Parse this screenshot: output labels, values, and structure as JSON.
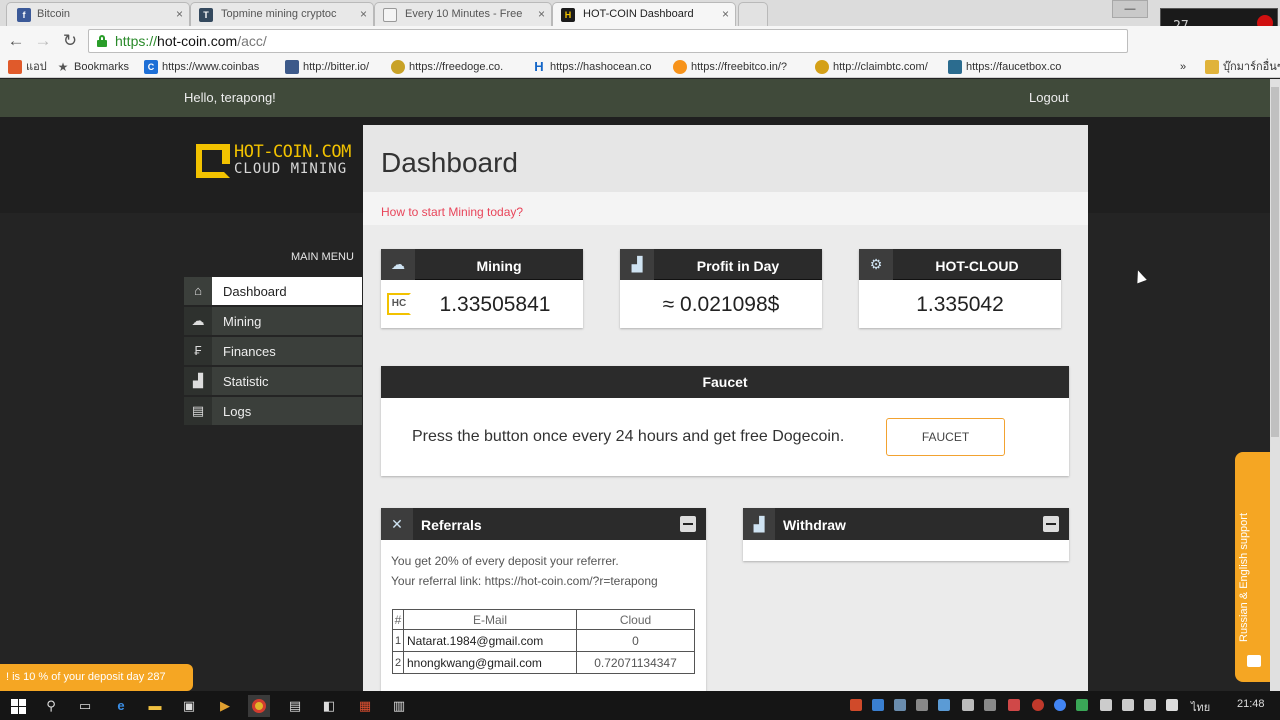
{
  "browser": {
    "tabs": [
      {
        "title": "Bitcoin",
        "icon": "facebook-icon",
        "color": "#3b5998",
        "glyph": "f"
      },
      {
        "title": "Topmine mining cryptoc",
        "icon": "topmine-icon",
        "color": "#34495e",
        "glyph": "T"
      },
      {
        "title": "Every 10 Minutes - Free",
        "icon": "page-icon",
        "color": "#9e9e9e",
        "glyph": ""
      },
      {
        "title": "HOT-COIN Dashboard",
        "icon": "hotcoin-icon",
        "color": "#1b1b1b",
        "glyph": "H"
      }
    ],
    "url": {
      "scheme": "https://",
      "host": "hot-coin.com",
      "path": "/acc/"
    },
    "bookmarks": [
      {
        "label": "แอป",
        "icon": "apps-icon",
        "color": "#e05a2b",
        "glyph": ""
      },
      {
        "label": "Bookmarks",
        "icon": "star-icon",
        "color": "#666666",
        "glyph": "★"
      },
      {
        "label": "https://www.coinbas",
        "icon": "coinbase-icon",
        "color": "#1d6fd6",
        "glyph": "C"
      },
      {
        "label": "http://bitter.io/",
        "icon": "bitter-icon",
        "color": "#3d5a8a",
        "glyph": ""
      },
      {
        "label": "https://freedoge.co.",
        "icon": "freedoge-icon",
        "color": "#c8a227",
        "glyph": ""
      },
      {
        "label": "https://hashocean.co",
        "icon": "hashocean-icon",
        "color": "#1466c8",
        "glyph": "H"
      },
      {
        "label": "https://freebitco.in/?",
        "icon": "freebitco-icon",
        "color": "#f7931a",
        "glyph": ""
      },
      {
        "label": "http://claimbtc.com/",
        "icon": "claimbtc-icon",
        "color": "#d4a017",
        "glyph": ""
      },
      {
        "label": "https://faucetbox.co",
        "icon": "faucetbox-icon",
        "color": "#2b6c8f",
        "glyph": ""
      },
      {
        "label": "บุ๊กมาร์กอื่นๆ",
        "icon": "folder-icon",
        "color": "#e0b33a",
        "glyph": ""
      }
    ],
    "recorder_value": "27"
  },
  "site": {
    "greeting": "Hello, terapong!",
    "logout": "Logout",
    "logo": {
      "title": "HOT-COIN.COM",
      "subtitle": "CLOUD MINING"
    },
    "menu_heading": "MAIN MENU",
    "menu": [
      {
        "label": "Dashboard",
        "icon": "home-icon",
        "glyph": "⌂",
        "active": true
      },
      {
        "label": "Mining",
        "icon": "cloud-icon",
        "glyph": "☁",
        "active": false
      },
      {
        "label": "Finances",
        "icon": "finance-icon",
        "glyph": "₣",
        "active": false
      },
      {
        "label": "Statistic",
        "icon": "chart-icon",
        "glyph": "▟",
        "active": false
      },
      {
        "label": "Logs",
        "icon": "clipboard-icon",
        "glyph": "▤",
        "active": false
      }
    ],
    "page_title": "Dashboard",
    "hint_link": "How to start Mining today?",
    "stats": [
      {
        "label": "Mining",
        "value": "1.33505841",
        "icon": "cloud-icon",
        "glyph": "☁",
        "badge": "HC"
      },
      {
        "label": "Profit in Day",
        "value": "≈ 0.021098$",
        "icon": "bar-chart-icon",
        "glyph": "▟",
        "badge": ""
      },
      {
        "label": "HOT-CLOUD",
        "value": "1.335042",
        "icon": "gear-icon",
        "glyph": "⚙",
        "badge": ""
      }
    ],
    "faucet": {
      "title": "Faucet",
      "text": "Press the button once every 24 hours and get free Dogecoin.",
      "button": "FAUCET"
    },
    "referrals": {
      "title": "Referrals",
      "line1": "You get 20% of every deposit your referrer.",
      "line2": "Your referral link: https://hot-coin.com/?r=terapong",
      "columns": [
        "#",
        "E-Mail",
        "Cloud"
      ],
      "rows": [
        {
          "num": "1",
          "email": "Natarat.1984@gmail.com",
          "cloud": "0"
        },
        {
          "num": "2",
          "email": "hnongkwang@gmail.com",
          "cloud": "0.72071134347"
        }
      ]
    },
    "withdraw": {
      "title": "Withdraw"
    },
    "promo": "! is 10 % of your deposit day  287",
    "support": "Russian & English support"
  },
  "taskbar": {
    "lang": "ไทย",
    "time": "21:48"
  },
  "colors": {
    "accent": "#f5a623",
    "link": "#e8455a",
    "brand": "#f2c200",
    "dark_header": "#2b2b2b"
  }
}
